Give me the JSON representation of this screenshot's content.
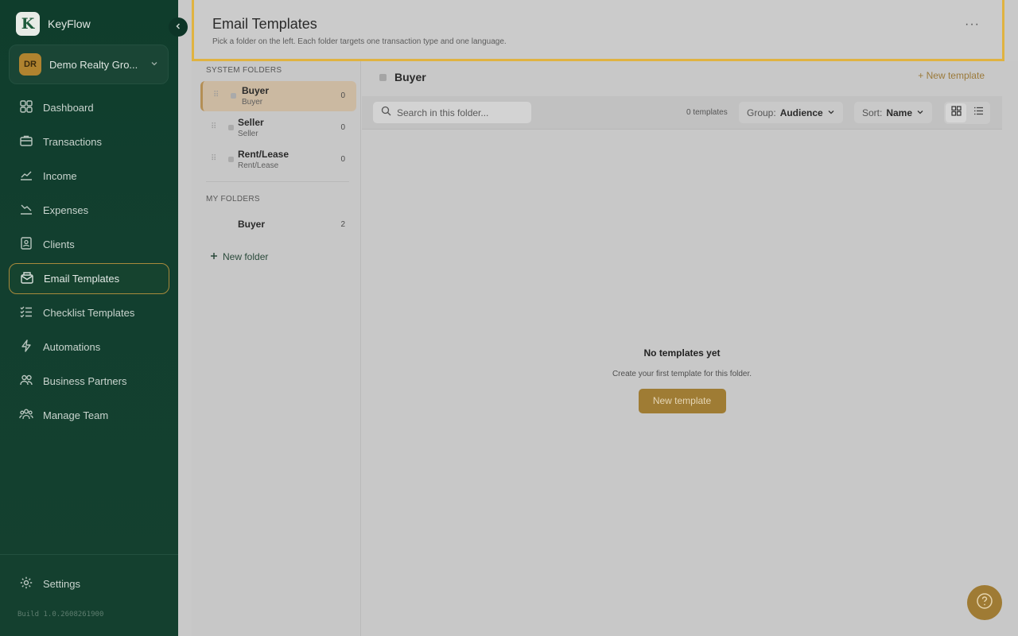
{
  "app": {
    "name": "KeyFlow",
    "logo_letter": "K"
  },
  "org": {
    "initials": "DR",
    "name": "Demo Realty Gro..."
  },
  "nav": [
    {
      "label": "Dashboard",
      "icon": "dashboard-icon"
    },
    {
      "label": "Transactions",
      "icon": "briefcase-icon"
    },
    {
      "label": "Income",
      "icon": "trend-up-icon"
    },
    {
      "label": "Expenses",
      "icon": "trend-down-icon"
    },
    {
      "label": "Clients",
      "icon": "contacts-icon"
    },
    {
      "label": "Email Templates",
      "icon": "mail-icon",
      "active": true
    },
    {
      "label": "Checklist Templates",
      "icon": "checklist-icon"
    },
    {
      "label": "Automations",
      "icon": "bolt-icon"
    },
    {
      "label": "Business Partners",
      "icon": "partners-icon"
    },
    {
      "label": "Manage Team",
      "icon": "team-icon"
    }
  ],
  "settings_label": "Settings",
  "build": "Build 1.0.2608261900",
  "header": {
    "title": "Email Templates",
    "subtitle": "Pick a folder on the left. Each folder targets one transaction type and one language.",
    "more": "···"
  },
  "folders": {
    "system_label": "SYSTEM FOLDERS",
    "system": [
      {
        "name": "Buyer",
        "sub": "Buyer",
        "count": "0",
        "active": true
      },
      {
        "name": "Seller",
        "sub": "Seller",
        "count": "0"
      },
      {
        "name": "Rent/Lease",
        "sub": "Rent/Lease",
        "count": "0"
      }
    ],
    "my_label": "MY FOLDERS",
    "mine": [
      {
        "name": "Buyer",
        "count": "2"
      }
    ],
    "new_folder": "New folder"
  },
  "main": {
    "folder_title": "Buyer",
    "new_template_link": "+ New template",
    "search_placeholder": "Search in this folder...",
    "template_count": "0 templates",
    "group": {
      "label": "Group:",
      "value": "Audience"
    },
    "sort": {
      "label": "Sort:",
      "value": "Name"
    },
    "empty_title": "No templates yet",
    "empty_sub": "Create your first template for this folder.",
    "empty_button": "New template"
  },
  "colors": {
    "accent": "#9f7c34",
    "sidebar": "#0f3d2c",
    "highlight": "#e0b341"
  }
}
